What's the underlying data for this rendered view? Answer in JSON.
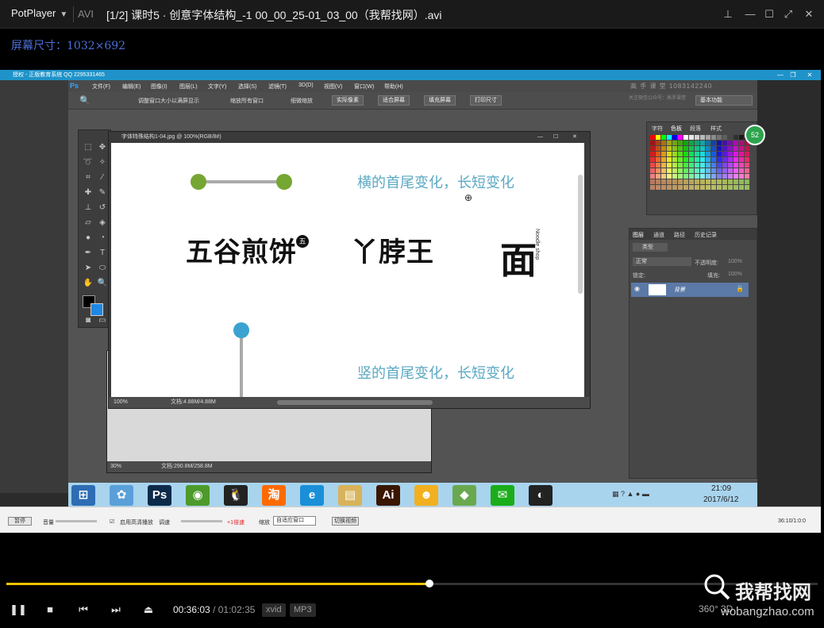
{
  "player": {
    "brand": "PotPlayer",
    "format": "AVI",
    "title": "[1/2] 课时5 · 创意字体结构_-1 00_00_25-01_03_00（我帮找网）.avi"
  },
  "screen_label": "屏幕尺寸：1032×692",
  "remote_desktop_title": "授权 - 正版教育系统 QQ 2295331465",
  "photoshop": {
    "logo": "Ps",
    "menu": [
      "文件(F)",
      "编辑(E)",
      "图像(I)",
      "图层(L)",
      "文字(Y)",
      "选择(S)",
      "滤镜(T)",
      "3D(D)",
      "视图(V)",
      "窗口(W)",
      "帮助(H)"
    ],
    "options": [
      "调整窗口大小以满屏显示",
      "缩放所有窗口",
      "细微缩放"
    ],
    "option_buttons": [
      "实际像素",
      "适合屏幕",
      "填充屏幕",
      "打印尺寸"
    ],
    "workspace": "基本功能",
    "watermark": "高 手 课 堂  1083142240",
    "watermark_sub": "关注微信公众号：高手课堂",
    "doc_title": "字体特殊结构1-04.jpg @ 100%(RGB/8#)",
    "zoom": "100%",
    "doc_info": "文档:4.88M/4.88M",
    "doc2_zoom": "30%",
    "doc2_info": "文档:290.8M/258.8M",
    "canvas": {
      "text_horizontal": "横的首尾变化，长短变化",
      "text_vertical": "竖的首尾变化，长短变化",
      "logo_1": "五谷煎饼",
      "logo_1_badge": "五",
      "logo_2": "丫脖王",
      "logo_3": "面",
      "logo_3_side": "Noodle shop"
    },
    "swatch_tabs": [
      "字符",
      "色板",
      "段落",
      "样式"
    ],
    "layer_tabs": [
      "图层",
      "通道",
      "路径",
      "历史记录"
    ],
    "layer_kind": "类型",
    "blend_mode": "正常",
    "opacity_label": "不透明度:",
    "opacity_value": "100%",
    "lock_label": "锁定:",
    "fill_label": "填充:",
    "fill_value": "100%",
    "layer_name": "背景",
    "badge": "52"
  },
  "taskbar": {
    "time": "21:09",
    "date": "2017/6/12",
    "icons": [
      {
        "name": "start-icon",
        "glyph": "⊞",
        "color": "#2e6db3"
      },
      {
        "name": "flower-icon",
        "glyph": "✿",
        "color": "#5a9fd9"
      },
      {
        "name": "photoshop-icon",
        "glyph": "Ps",
        "color": "#0b2a4a"
      },
      {
        "name": "app-green-icon",
        "glyph": "◉",
        "color": "#4c9a2a"
      },
      {
        "name": "qq-icon",
        "glyph": "🐧",
        "color": "#222"
      },
      {
        "name": "taobao-icon",
        "glyph": "淘",
        "color": "#ff6a00"
      },
      {
        "name": "ie-icon",
        "glyph": "e",
        "color": "#1a8fd8"
      },
      {
        "name": "folder-icon",
        "glyph": "▤",
        "color": "#d8b35a"
      },
      {
        "name": "illustrator-icon",
        "glyph": "Ai",
        "color": "#3a1600"
      },
      {
        "name": "cat-app-icon",
        "glyph": "☻",
        "color": "#f2b01e"
      },
      {
        "name": "tool-icon",
        "glyph": "◆",
        "color": "#6aa84f"
      },
      {
        "name": "wechat-icon",
        "glyph": "✉",
        "color": "#1aad19"
      },
      {
        "name": "obs-icon",
        "glyph": "◐",
        "color": "#222"
      }
    ]
  },
  "recorder": {
    "btn": "暂停",
    "volume": "音量",
    "opt1": "启用高清播放",
    "speed": "调速",
    "speed_value": "+1倍速",
    "zoom": "缩放",
    "zoom_value": "自适应窗口",
    "switch": "切换视频",
    "timecode": "36:10/1:0:0"
  },
  "playback": {
    "current": "00:36:03",
    "separator": "/",
    "duration": "01:02:35",
    "video_codec": "xvid",
    "audio_codec": "MP3",
    "progress": 0.522,
    "indicator_left": "360°",
    "indicator_right": "3D"
  },
  "site_watermark": "我帮找网",
  "site_url": "wobangzhao.com"
}
